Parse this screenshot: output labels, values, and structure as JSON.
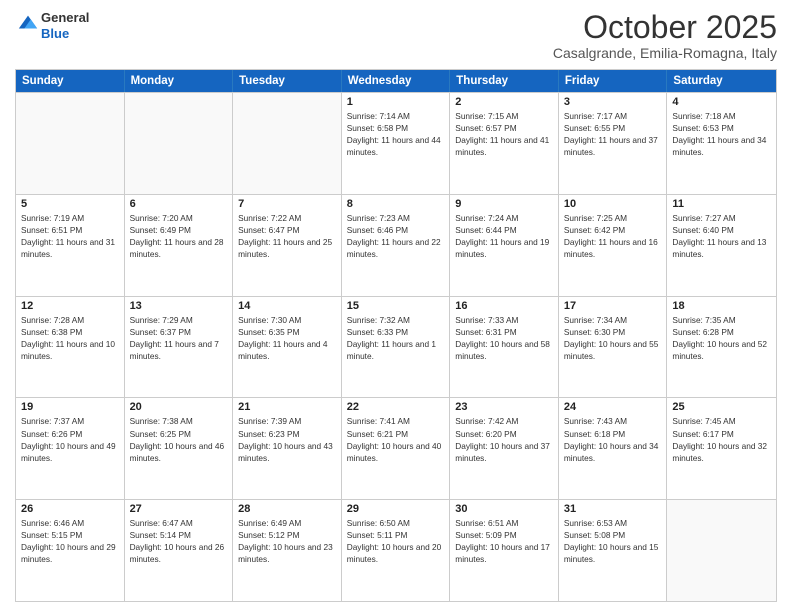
{
  "header": {
    "logo_line1": "General",
    "logo_line2": "Blue",
    "month": "October 2025",
    "location": "Casalgrande, Emilia-Romagna, Italy"
  },
  "days_of_week": [
    "Sunday",
    "Monday",
    "Tuesday",
    "Wednesday",
    "Thursday",
    "Friday",
    "Saturday"
  ],
  "weeks": [
    [
      {
        "day": "",
        "info": ""
      },
      {
        "day": "",
        "info": ""
      },
      {
        "day": "",
        "info": ""
      },
      {
        "day": "1",
        "info": "Sunrise: 7:14 AM\nSunset: 6:58 PM\nDaylight: 11 hours and 44 minutes."
      },
      {
        "day": "2",
        "info": "Sunrise: 7:15 AM\nSunset: 6:57 PM\nDaylight: 11 hours and 41 minutes."
      },
      {
        "day": "3",
        "info": "Sunrise: 7:17 AM\nSunset: 6:55 PM\nDaylight: 11 hours and 37 minutes."
      },
      {
        "day": "4",
        "info": "Sunrise: 7:18 AM\nSunset: 6:53 PM\nDaylight: 11 hours and 34 minutes."
      }
    ],
    [
      {
        "day": "5",
        "info": "Sunrise: 7:19 AM\nSunset: 6:51 PM\nDaylight: 11 hours and 31 minutes."
      },
      {
        "day": "6",
        "info": "Sunrise: 7:20 AM\nSunset: 6:49 PM\nDaylight: 11 hours and 28 minutes."
      },
      {
        "day": "7",
        "info": "Sunrise: 7:22 AM\nSunset: 6:47 PM\nDaylight: 11 hours and 25 minutes."
      },
      {
        "day": "8",
        "info": "Sunrise: 7:23 AM\nSunset: 6:46 PM\nDaylight: 11 hours and 22 minutes."
      },
      {
        "day": "9",
        "info": "Sunrise: 7:24 AM\nSunset: 6:44 PM\nDaylight: 11 hours and 19 minutes."
      },
      {
        "day": "10",
        "info": "Sunrise: 7:25 AM\nSunset: 6:42 PM\nDaylight: 11 hours and 16 minutes."
      },
      {
        "day": "11",
        "info": "Sunrise: 7:27 AM\nSunset: 6:40 PM\nDaylight: 11 hours and 13 minutes."
      }
    ],
    [
      {
        "day": "12",
        "info": "Sunrise: 7:28 AM\nSunset: 6:38 PM\nDaylight: 11 hours and 10 minutes."
      },
      {
        "day": "13",
        "info": "Sunrise: 7:29 AM\nSunset: 6:37 PM\nDaylight: 11 hours and 7 minutes."
      },
      {
        "day": "14",
        "info": "Sunrise: 7:30 AM\nSunset: 6:35 PM\nDaylight: 11 hours and 4 minutes."
      },
      {
        "day": "15",
        "info": "Sunrise: 7:32 AM\nSunset: 6:33 PM\nDaylight: 11 hours and 1 minute."
      },
      {
        "day": "16",
        "info": "Sunrise: 7:33 AM\nSunset: 6:31 PM\nDaylight: 10 hours and 58 minutes."
      },
      {
        "day": "17",
        "info": "Sunrise: 7:34 AM\nSunset: 6:30 PM\nDaylight: 10 hours and 55 minutes."
      },
      {
        "day": "18",
        "info": "Sunrise: 7:35 AM\nSunset: 6:28 PM\nDaylight: 10 hours and 52 minutes."
      }
    ],
    [
      {
        "day": "19",
        "info": "Sunrise: 7:37 AM\nSunset: 6:26 PM\nDaylight: 10 hours and 49 minutes."
      },
      {
        "day": "20",
        "info": "Sunrise: 7:38 AM\nSunset: 6:25 PM\nDaylight: 10 hours and 46 minutes."
      },
      {
        "day": "21",
        "info": "Sunrise: 7:39 AM\nSunset: 6:23 PM\nDaylight: 10 hours and 43 minutes."
      },
      {
        "day": "22",
        "info": "Sunrise: 7:41 AM\nSunset: 6:21 PM\nDaylight: 10 hours and 40 minutes."
      },
      {
        "day": "23",
        "info": "Sunrise: 7:42 AM\nSunset: 6:20 PM\nDaylight: 10 hours and 37 minutes."
      },
      {
        "day": "24",
        "info": "Sunrise: 7:43 AM\nSunset: 6:18 PM\nDaylight: 10 hours and 34 minutes."
      },
      {
        "day": "25",
        "info": "Sunrise: 7:45 AM\nSunset: 6:17 PM\nDaylight: 10 hours and 32 minutes."
      }
    ],
    [
      {
        "day": "26",
        "info": "Sunrise: 6:46 AM\nSunset: 5:15 PM\nDaylight: 10 hours and 29 minutes."
      },
      {
        "day": "27",
        "info": "Sunrise: 6:47 AM\nSunset: 5:14 PM\nDaylight: 10 hours and 26 minutes."
      },
      {
        "day": "28",
        "info": "Sunrise: 6:49 AM\nSunset: 5:12 PM\nDaylight: 10 hours and 23 minutes."
      },
      {
        "day": "29",
        "info": "Sunrise: 6:50 AM\nSunset: 5:11 PM\nDaylight: 10 hours and 20 minutes."
      },
      {
        "day": "30",
        "info": "Sunrise: 6:51 AM\nSunset: 5:09 PM\nDaylight: 10 hours and 17 minutes."
      },
      {
        "day": "31",
        "info": "Sunrise: 6:53 AM\nSunset: 5:08 PM\nDaylight: 10 hours and 15 minutes."
      },
      {
        "day": "",
        "info": ""
      }
    ]
  ]
}
